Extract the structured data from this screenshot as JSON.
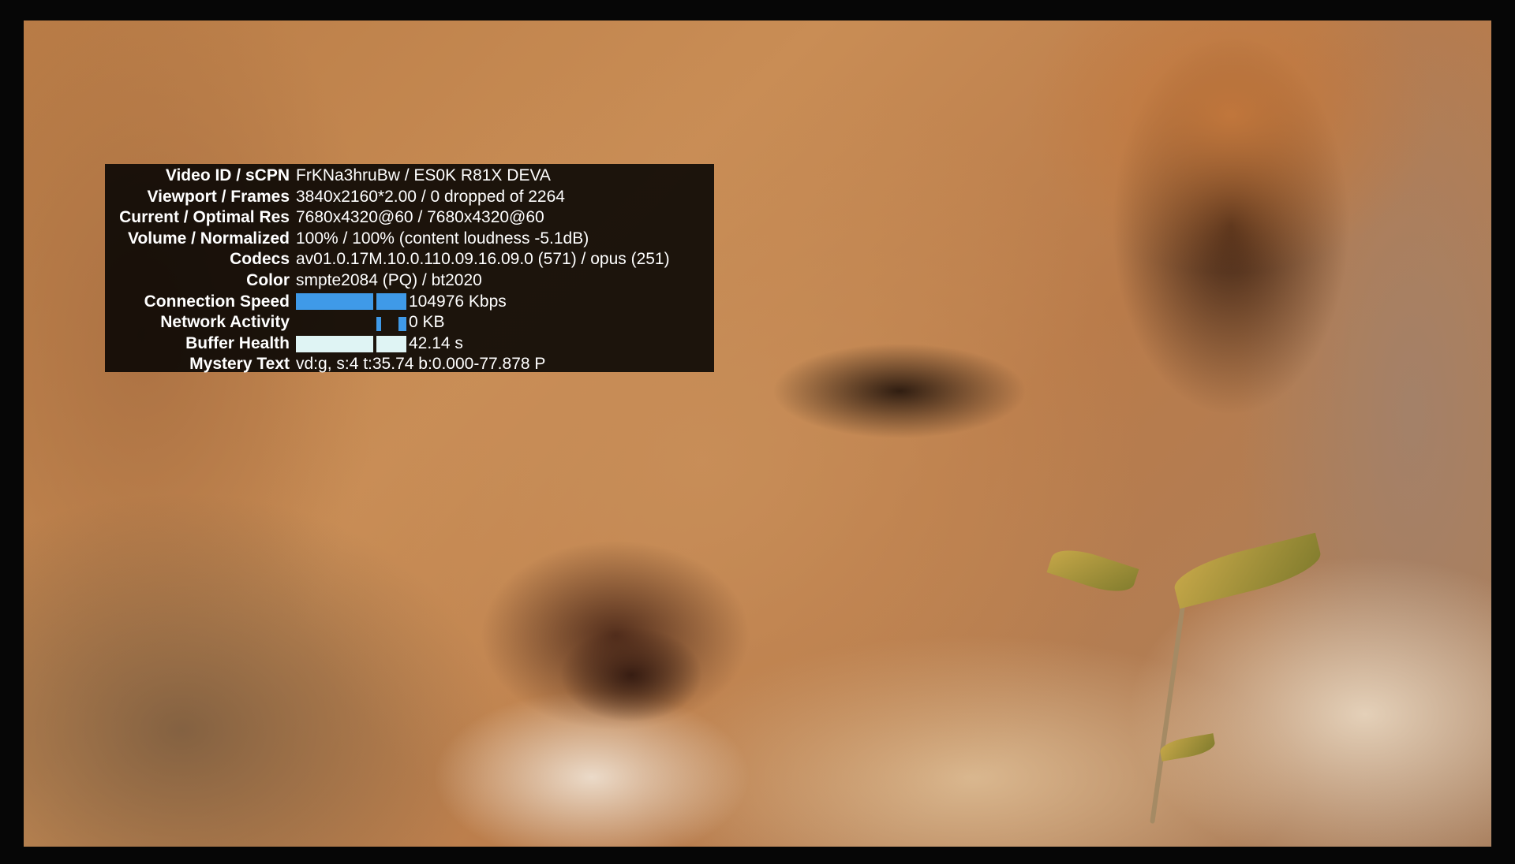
{
  "colors": {
    "overlay_background": "#000000",
    "text": "#ffffff",
    "connection_speed_graph": "#3f9ae8",
    "network_activity_graph": "#3f9ae8",
    "buffer_health_graph": "#dff4f4"
  },
  "stats_for_nerds": {
    "rows": [
      {
        "label": "Video ID / sCPN",
        "value": "FrKNa3hruBw / ES0K R81X DEVA"
      },
      {
        "label": "Viewport / Frames",
        "value": "3840x2160*2.00 / 0 dropped of 2264"
      },
      {
        "label": "Current / Optimal Res",
        "value": "7680x4320@60 / 7680x4320@60"
      },
      {
        "label": "Volume / Normalized",
        "value": "100% / 100% (content loudness -5.1dB)"
      },
      {
        "label": "Codecs",
        "value": "av01.0.17M.10.0.110.09.16.09.0 (571) / opus (251)"
      },
      {
        "label": "Color",
        "value": "smpte2084 (PQ) / bt2020"
      },
      {
        "label": "Connection Speed",
        "value": "104976 Kbps"
      },
      {
        "label": "Network Activity",
        "value": "0 KB"
      },
      {
        "label": "Buffer Health",
        "value": "42.14 s"
      },
      {
        "label": "Mystery Text",
        "value": "vd:g, s:4 t:35.74 b:0.000-77.878 P"
      }
    ]
  }
}
